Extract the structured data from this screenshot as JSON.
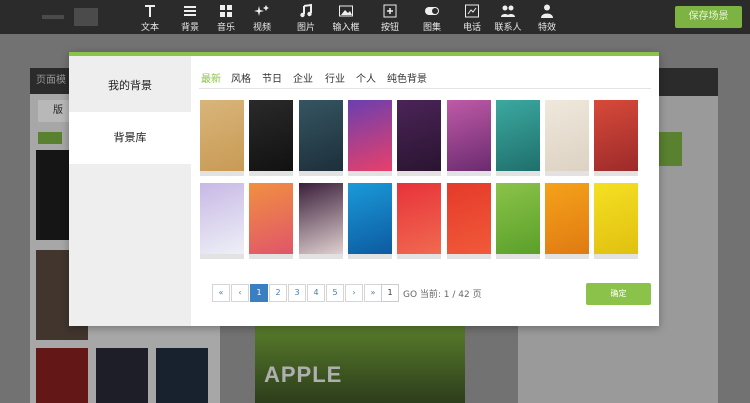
{
  "toolbar": {
    "tools": [
      {
        "label": "文本",
        "icon": "text-icon"
      },
      {
        "label": "背景",
        "icon": "list-icon"
      },
      {
        "label": "音乐",
        "icon": "grid-icon"
      },
      {
        "label": "视频",
        "icon": "sparkle-icon"
      },
      {
        "label": "图片",
        "icon": "music-note-icon"
      },
      {
        "label": "输入框",
        "icon": "image-icon"
      },
      {
        "label": "按钮",
        "icon": "button-icon"
      },
      {
        "label": "图集",
        "icon": "toggle-icon"
      },
      {
        "label": "电话",
        "icon": "chart-icon"
      },
      {
        "label": "联系人",
        "icon": "contacts-icon"
      },
      {
        "label": "特效",
        "icon": "person-icon"
      }
    ],
    "save_label": "保存场景"
  },
  "editor": {
    "left_panel_title": "页面模",
    "left_tab": "版",
    "phone_title": "APPLE"
  },
  "modal": {
    "side": {
      "my_backgrounds": "我的背景",
      "library": "背景库"
    },
    "categories": [
      "最新",
      "风格",
      "节日",
      "企业",
      "行业",
      "个人",
      "纯色背景"
    ],
    "active_category": "最新",
    "tiles": [
      {
        "name": "wood",
        "colors": [
          "#d9b57a",
          "#c89a55"
        ]
      },
      {
        "name": "dark-diamond",
        "colors": [
          "#2a2a2a",
          "#111111"
        ]
      },
      {
        "name": "dark-teal",
        "colors": [
          "#355562",
          "#1d2f3a"
        ]
      },
      {
        "name": "colorful-gradient",
        "colors": [
          "#6a3fb0",
          "#e8406a"
        ]
      },
      {
        "name": "purple-dark",
        "colors": [
          "#4b2458",
          "#2a1430"
        ]
      },
      {
        "name": "daisy-pink",
        "colors": [
          "#c05aa8",
          "#6a2b6e"
        ]
      },
      {
        "name": "teal-floral",
        "colors": [
          "#3ba9a0",
          "#1f6f6c"
        ]
      },
      {
        "name": "light-pattern",
        "colors": [
          "#efe8dc",
          "#ddd2c3"
        ]
      },
      {
        "name": "red-gradient",
        "colors": [
          "#d84a3a",
          "#9c2a2a"
        ]
      },
      {
        "name": "lavender-geo",
        "colors": [
          "#c8b8e6",
          "#eef0f6"
        ]
      },
      {
        "name": "orange-polygon",
        "colors": [
          "#f19040",
          "#e0556a"
        ]
      },
      {
        "name": "night-clouds",
        "colors": [
          "#3a1f3a",
          "#e0d0d0"
        ]
      },
      {
        "name": "blue-polygon",
        "colors": [
          "#1a9ad9",
          "#0d5aa0"
        ]
      },
      {
        "name": "red-bokeh",
        "colors": [
          "#e8323a",
          "#f06a50"
        ]
      },
      {
        "name": "red-solid",
        "colors": [
          "#e53a2a",
          "#f05a3a"
        ]
      },
      {
        "name": "green-gradient",
        "colors": [
          "#8bc34a",
          "#5aa02a"
        ]
      },
      {
        "name": "orange-gradient",
        "colors": [
          "#f5a21a",
          "#e07a12"
        ]
      },
      {
        "name": "yellow-gradient",
        "colors": [
          "#f5e023",
          "#e0c010"
        ]
      }
    ],
    "pagination": {
      "first": "«",
      "prev": "‹",
      "pages": [
        "1",
        "2",
        "3",
        "4",
        "5"
      ],
      "current_page": "1",
      "next": "›",
      "last": "»",
      "goto_value": "1",
      "go_text": "GO 当前: 1 / 42 页"
    },
    "confirm_label": "确定"
  }
}
